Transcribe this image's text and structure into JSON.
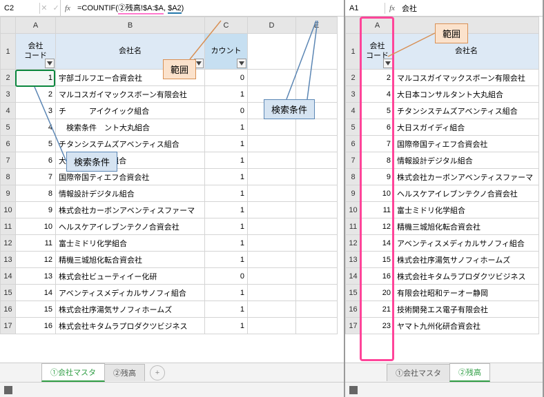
{
  "left": {
    "name_box": "C2",
    "fx": "fx",
    "formula_prefix": "=COUNTIF(",
    "formula_range": "②残高!$A:$A",
    "formula_sep": ", ",
    "formula_crit": "$A2",
    "formula_suffix": ")",
    "cols": [
      "A",
      "B",
      "C",
      "D",
      "E"
    ],
    "hdr": {
      "code": "会社\nコード",
      "name": "会社名",
      "count": "カウント"
    },
    "rows": [
      {
        "n": 1
      },
      {
        "n": 2,
        "code": "1",
        "name": "宇部ゴルフエー合資会社",
        "cnt": "0"
      },
      {
        "n": 3,
        "code": "2",
        "name": "マルコスガイマックスボーン有限会社",
        "cnt": "1"
      },
      {
        "n": 4,
        "code": "3",
        "name": "チ　　　アイクイック組合",
        "cnt": "0"
      },
      {
        "n": 5,
        "code": "4",
        "name": "　検索条件　ント大丸組合",
        "cnt": "1"
      },
      {
        "n": 6,
        "code": "5",
        "name": "チタンシステムズアベンティス組合",
        "cnt": "1"
      },
      {
        "n": 7,
        "code": "6",
        "name": "大日スガイディ組合",
        "cnt": "1"
      },
      {
        "n": 8,
        "code": "7",
        "name": "国際帝国ティエフ合資会社",
        "cnt": "1"
      },
      {
        "n": 9,
        "code": "8",
        "name": "情報設計デジタル組合",
        "cnt": "1"
      },
      {
        "n": 10,
        "code": "9",
        "name": "株式会社カーボンアベンティスファーマ",
        "cnt": "1"
      },
      {
        "n": 11,
        "code": "10",
        "name": "ヘルスケアイレブンテクノ合資会社",
        "cnt": "1"
      },
      {
        "n": 12,
        "code": "11",
        "name": "富士ミドリ化学組合",
        "cnt": "1"
      },
      {
        "n": 13,
        "code": "12",
        "name": "精機三城旭化転合資会社",
        "cnt": "1"
      },
      {
        "n": 14,
        "code": "13",
        "name": "株式会社ビューティイー化研",
        "cnt": "0"
      },
      {
        "n": 15,
        "code": "14",
        "name": "アベンティスメディカルサノフィ組合",
        "cnt": "1"
      },
      {
        "n": 16,
        "code": "15",
        "name": "株式会社序湯気サノフィホームズ",
        "cnt": "1"
      },
      {
        "n": 17,
        "code": "16",
        "name": "株式会社キタムラプロダクツビジネス",
        "cnt": "1"
      }
    ],
    "tabs": {
      "active": "①会社マスタ",
      "other": "②残高",
      "add": "+"
    },
    "callouts": {
      "range": "範囲",
      "crit": "検索条件"
    }
  },
  "right": {
    "name_box": "A1",
    "fx": "fx",
    "formula": "会社",
    "cols": [
      "A"
    ],
    "hdr": {
      "code": "会社\nコード",
      "name": "会社名"
    },
    "rows": [
      {
        "n": 1
      },
      {
        "n": 2,
        "code": "2",
        "name": "マルコスガイマックスボーン有限会社"
      },
      {
        "n": 3,
        "code": "4",
        "name": "大日本コンサルタント大丸組合"
      },
      {
        "n": 4,
        "code": "5",
        "name": "チタンシステムズアベンティス組合"
      },
      {
        "n": 5,
        "code": "6",
        "name": "大日スガイディ組合"
      },
      {
        "n": 6,
        "code": "7",
        "name": "国際帝国ティエフ合資会社"
      },
      {
        "n": 7,
        "code": "8",
        "name": "情報設計デジタル組合"
      },
      {
        "n": 8,
        "code": "9",
        "name": "株式会社カーボンアベンティスファーマ"
      },
      {
        "n": 9,
        "code": "10",
        "name": "ヘルスケアイレブンテクノ合資会社"
      },
      {
        "n": 10,
        "code": "11",
        "name": "富士ミドリ化学組合"
      },
      {
        "n": 11,
        "code": "12",
        "name": "精機三城旭化転合資会社"
      },
      {
        "n": 12,
        "code": "14",
        "name": "アベンティスメディカルサノフィ組合"
      },
      {
        "n": 13,
        "code": "15",
        "name": "株式会社序湯気サノフィホームズ"
      },
      {
        "n": 14,
        "code": "16",
        "name": "株式会社キタムラプロダクツビジネス"
      },
      {
        "n": 15,
        "code": "20",
        "name": "有限会社昭和テーオー静岡"
      },
      {
        "n": 16,
        "code": "21",
        "name": "技術開発エス電子有限会社"
      },
      {
        "n": 17,
        "code": "23",
        "name": "ヤマト九州化研合資会社"
      }
    ],
    "tabs": {
      "other": "①会社マスタ",
      "active": "②残高"
    },
    "callouts": {
      "range": "範囲"
    }
  }
}
